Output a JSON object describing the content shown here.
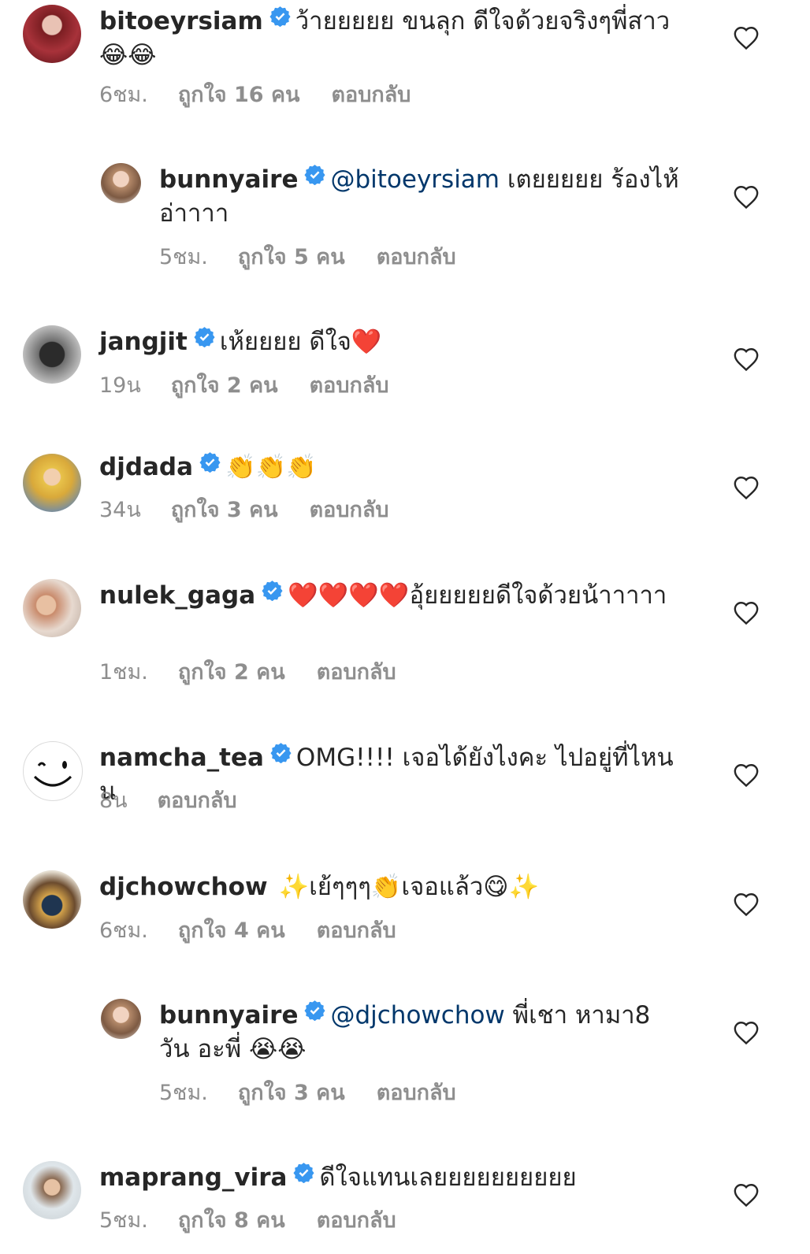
{
  "comments": [
    {
      "username": "bitoeyrsiam",
      "mention": "",
      "text": "ว้ายยยยย ขนลุก ดีใจด้วยจริงๆพี่สาว 😂😂",
      "time": "6ชม.",
      "likes": "ถูกใจ 16 คน",
      "reply": "ตอบกลับ"
    },
    {
      "username": "bunnyaire",
      "mention": "@bitoeyrsiam",
      "text": "เตยยยยย ร้องไห้อ่าาาา",
      "time": "5ชม.",
      "likes": "ถูกใจ 5 คน",
      "reply": "ตอบกลับ"
    },
    {
      "username": "jangjit",
      "mention": "",
      "text": "เห้ยยยย ดีใจ❤️",
      "time": "19น",
      "likes": "ถูกใจ 2 คน",
      "reply": "ตอบกลับ"
    },
    {
      "username": "djdada",
      "mention": "",
      "text": "👏👏👏",
      "time": "34น",
      "likes": "ถูกใจ 3 คน",
      "reply": "ตอบกลับ"
    },
    {
      "username": "nulek_gaga",
      "mention": "",
      "text": "❤️❤️❤️❤️อุ้ยยยยยดีใจด้วยน้าาาาา",
      "time": "1ชม.",
      "likes": "ถูกใจ 2 คน",
      "reply": "ตอบกลับ"
    },
    {
      "username": "namcha_tea",
      "mention": "",
      "text": "OMG!!!! เจอได้ยังไงคะ ไปอยู่ที่ไหนน",
      "time": "8น",
      "likes": "",
      "reply": "ตอบกลับ"
    },
    {
      "username": "djchowchow",
      "mention": "",
      "text": "✨เย้ๆๆๆ👏เจอแล้ว😋✨",
      "time": "6ชม.",
      "likes": "ถูกใจ 4 คน",
      "reply": "ตอบกลับ"
    },
    {
      "username": "bunnyaire",
      "mention": "@djchowchow",
      "text": "พี่เชา หามา8 วัน อะพี่ 😭😭",
      "time": "5ชม.",
      "likes": "ถูกใจ 3 คน",
      "reply": "ตอบกลับ"
    },
    {
      "username": "maprang_vira",
      "mention": "",
      "text": "ดีใจแทนเลยยยยยยยยยย",
      "time": "5ชม.",
      "likes": "ถูกใจ 8 คน",
      "reply": "ตอบกลับ"
    }
  ],
  "colors": {
    "text": "#262626",
    "meta": "#8e8e8e",
    "mention": "#00376b",
    "verified": "#3897f0"
  },
  "icons": {
    "verified": "verified-badge-icon",
    "like": "heart-outline-icon"
  }
}
